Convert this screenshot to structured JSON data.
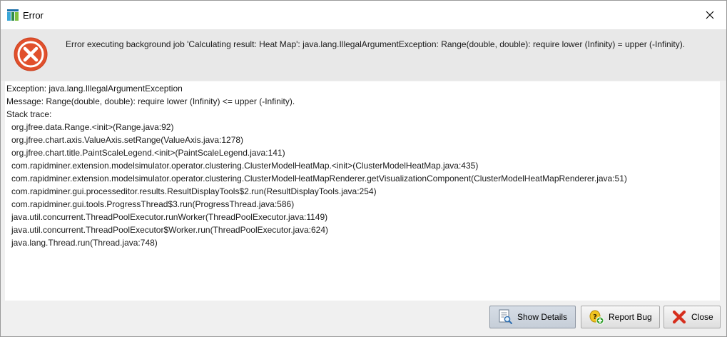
{
  "window": {
    "title": "Error",
    "app_icon": "rapidminer-logo-icon",
    "close_icon": "close-icon"
  },
  "header": {
    "icon": "error-x-icon",
    "icon_color": "#e1502c",
    "message": "Error executing background job 'Calculating result: Heat Map': java.lang.IllegalArgumentException: Range(double, double): require lower (Infinity) = upper (-Infinity)."
  },
  "details": {
    "exception_line": "Exception: java.lang.IllegalArgumentException",
    "message_line": "Message: Range(double, double): require lower (Infinity) <= upper (-Infinity).",
    "stack_label": "Stack trace:",
    "stack_trace": [
      "org.jfree.data.Range.<init>(Range.java:92)",
      "org.jfree.chart.axis.ValueAxis.setRange(ValueAxis.java:1278)",
      "org.jfree.chart.title.PaintScaleLegend.<init>(PaintScaleLegend.java:141)",
      "com.rapidminer.extension.modelsimulator.operator.clustering.ClusterModelHeatMap.<init>(ClusterModelHeatMap.java:435)",
      "com.rapidminer.extension.modelsimulator.operator.clustering.ClusterModelHeatMapRenderer.getVisualizationComponent(ClusterModelHeatMapRenderer.java:51)",
      "com.rapidminer.gui.processeditor.results.ResultDisplayTools$2.run(ResultDisplayTools.java:254)",
      "com.rapidminer.gui.tools.ProgressThread$3.run(ProgressThread.java:586)",
      "java.util.concurrent.ThreadPoolExecutor.runWorker(ThreadPoolExecutor.java:1149)",
      "java.util.concurrent.ThreadPoolExecutor$Worker.run(ThreadPoolExecutor.java:624)",
      "java.lang.Thread.run(Thread.java:748)"
    ]
  },
  "buttons": {
    "show_details": {
      "label": "Show Details",
      "icon": "document-search-icon",
      "state": "pressed"
    },
    "report_bug": {
      "label": "Report Bug",
      "icon": "bug-report-icon"
    },
    "close": {
      "label": "Close",
      "icon": "red-x-icon"
    }
  },
  "colors": {
    "error_red": "#e1502c",
    "header_bg": "#e8e8e8",
    "dialog_bg": "#f0f0f0"
  }
}
